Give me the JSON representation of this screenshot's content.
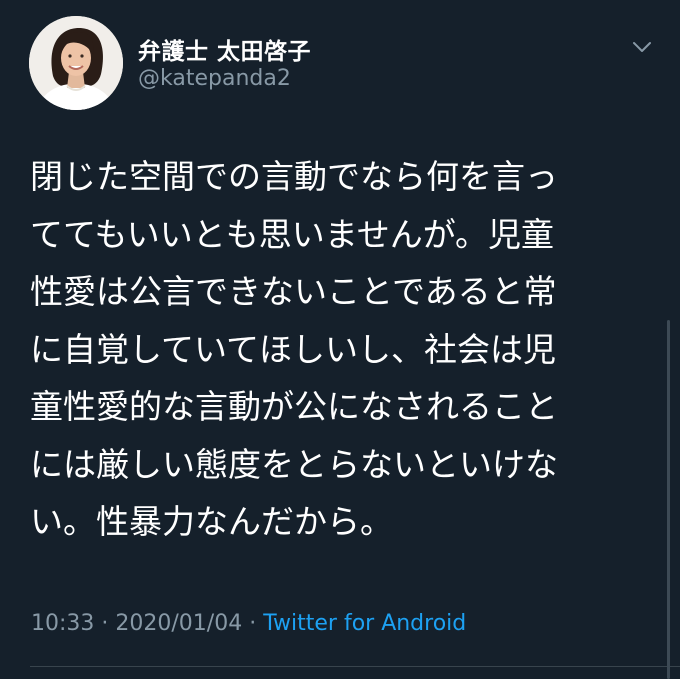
{
  "user": {
    "display_name": "弁護士 太田啓子",
    "handle": "@katepanda2"
  },
  "tweet": {
    "lines": [
      "閉じた空間での言動でなら何を言っ",
      "ててもいいとも思いませんが。児童",
      "性愛は公言できないことであると常",
      "に自覚していてほしいし、社会は児",
      "童性愛的な言動が公になされること",
      "には厳しい態度をとらないといけな",
      "い。性暴力なんだから。"
    ],
    "time": "10:33",
    "date": "2020/01/04",
    "separator": "·",
    "source": "Twitter for Android"
  },
  "icons": {
    "avatar": "profile-photo",
    "more": "chevron-down-icon"
  },
  "colors": {
    "background": "#15202b",
    "text": "#ffffff",
    "secondary": "#8899a6",
    "link": "#1da1f2"
  }
}
